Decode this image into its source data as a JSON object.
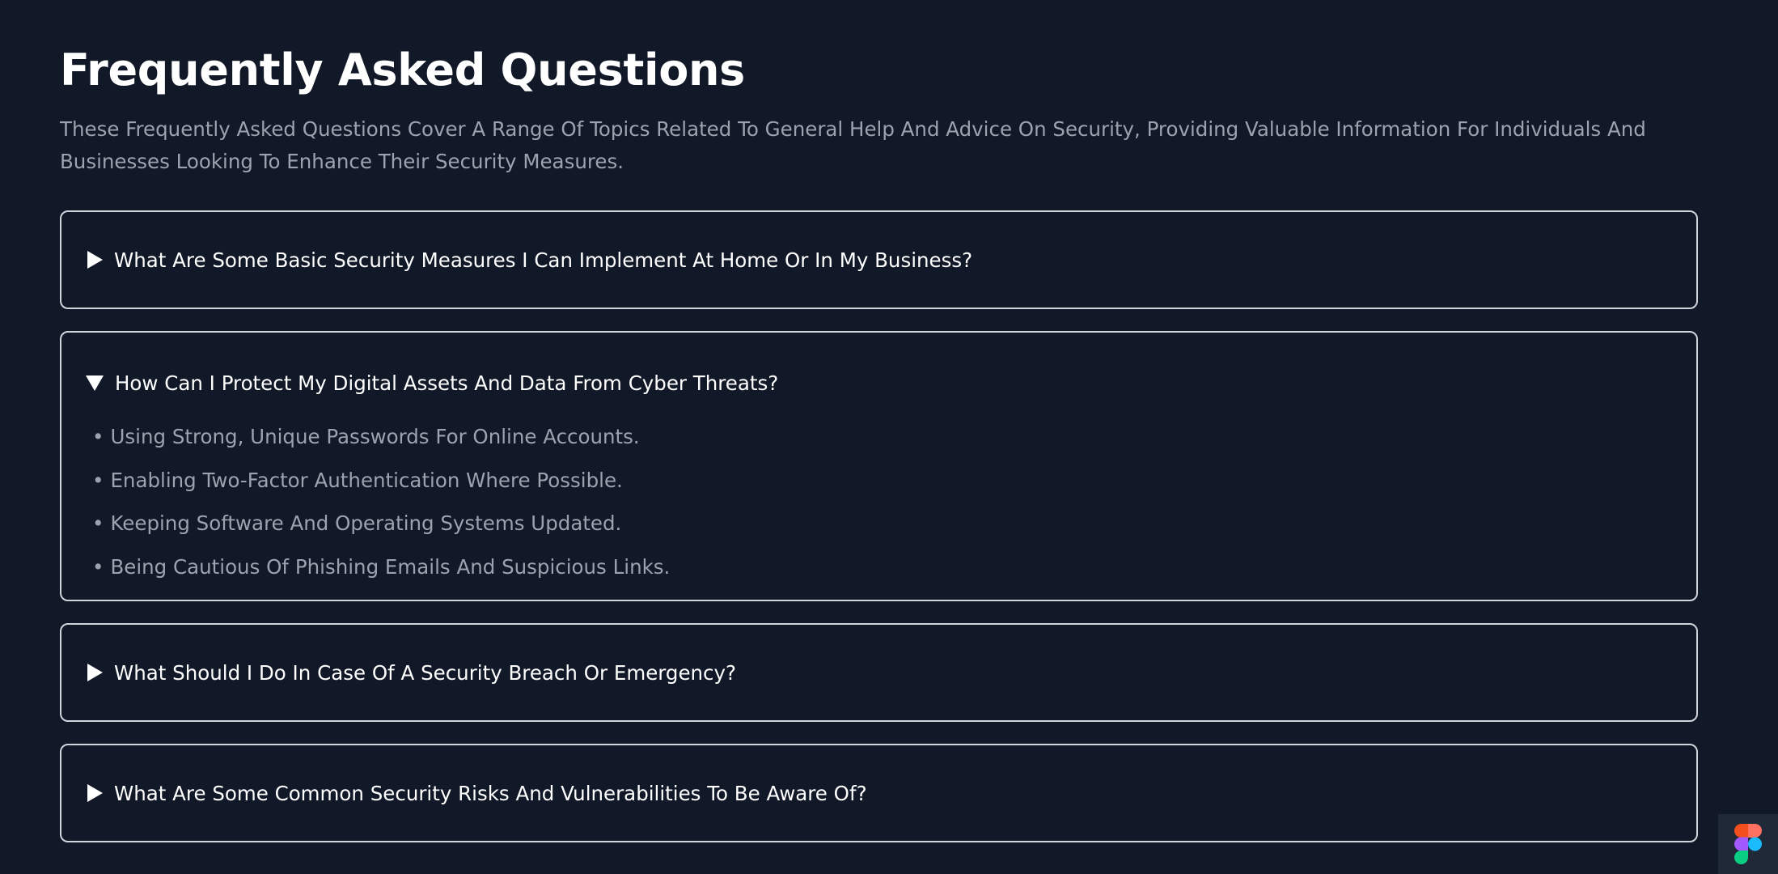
{
  "header": {
    "title": "Frequently Asked Questions",
    "description": "These Frequently Asked Questions Cover A Range Of Topics Related To General Help And Advice On Security, Providing Valuable Information For Individuals And Businesses Looking To Enhance Their Security Measures."
  },
  "faq": [
    {
      "question": "What Are Some Basic Security Measures I Can Implement At Home Or In My Business?",
      "expanded": false
    },
    {
      "question": "How Can I Protect My Digital Assets And Data From Cyber Threats?",
      "expanded": true,
      "answer": [
        "Using Strong, Unique Passwords For Online Accounts.",
        "Enabling Two-Factor Authentication Where Possible.",
        "Keeping Software And Operating Systems Updated.",
        "Being Cautious Of Phishing Emails And Suspicious Links."
      ]
    },
    {
      "question": "What Should I Do In Case Of A Security Breach Or Emergency?",
      "expanded": false
    },
    {
      "question": "What Are Some Common Security Risks And Vulnerabilities To Be Aware Of?",
      "expanded": false
    }
  ],
  "colors": {
    "background": "#111827",
    "text": "#ffffff",
    "muted": "#9ca3af",
    "border": "#d1d5db"
  },
  "icons": {
    "collapsed": "triangle-right-icon",
    "expanded": "triangle-down-icon",
    "badge": "figma-icon"
  }
}
